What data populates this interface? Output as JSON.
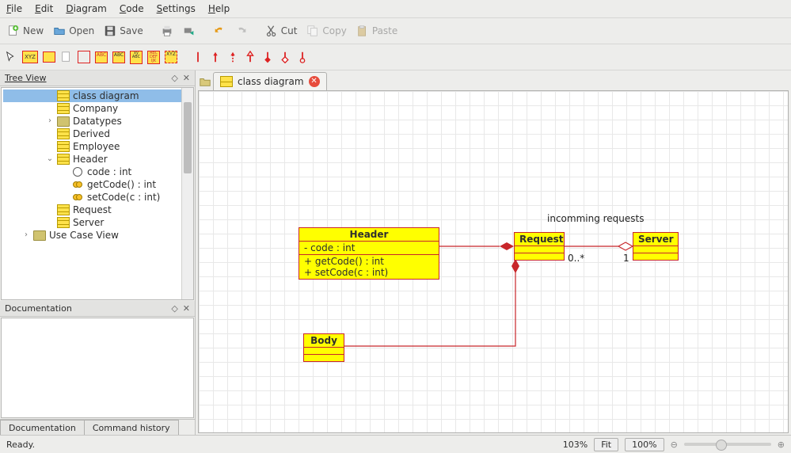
{
  "menu": {
    "file": "File",
    "edit": "Edit",
    "diagram": "Diagram",
    "code": "Code",
    "settings": "Settings",
    "help": "Help"
  },
  "toolbar": {
    "new": "New",
    "open": "Open",
    "save": "Save",
    "cut": "Cut",
    "copy": "Copy",
    "paste": "Paste"
  },
  "panels": {
    "tree_title": "Tree View",
    "doc_title": "Documentation"
  },
  "tree": {
    "items": [
      {
        "label": "class diagram",
        "icon": "class",
        "sel": true,
        "indent": 48,
        "exp": ""
      },
      {
        "label": "Company",
        "icon": "class",
        "indent": 48,
        "exp": ""
      },
      {
        "label": "Datatypes",
        "icon": "folder",
        "indent": 48,
        "exp": ">"
      },
      {
        "label": "Derived",
        "icon": "class",
        "indent": 48,
        "exp": ""
      },
      {
        "label": "Employee",
        "icon": "class",
        "indent": 48,
        "exp": ""
      },
      {
        "label": "Header",
        "icon": "class",
        "indent": 48,
        "exp": "v"
      },
      {
        "label": "code : int",
        "icon": "attr",
        "indent": 66,
        "exp": ""
      },
      {
        "label": "getCode() : int",
        "icon": "op",
        "indent": 66,
        "exp": ""
      },
      {
        "label": "setCode(c : int)",
        "icon": "op",
        "indent": 66,
        "exp": ""
      },
      {
        "label": "Request",
        "icon": "class",
        "indent": 48,
        "exp": ""
      },
      {
        "label": "Server",
        "icon": "class",
        "indent": 48,
        "exp": ""
      },
      {
        "label": "Use Case View",
        "icon": "folder",
        "indent": 18,
        "exp": ">"
      }
    ]
  },
  "bottabs": {
    "doc": "Documentation",
    "hist": "Command history"
  },
  "tab": {
    "label": "class diagram"
  },
  "uml": {
    "header": {
      "title": "Header",
      "attr": "- code : int",
      "op1": "+ getCode() : int",
      "op2": "+ setCode(c : int)"
    },
    "request": {
      "title": "Request"
    },
    "server": {
      "title": "Server"
    },
    "body": {
      "title": "Body"
    },
    "note": "incomming requests",
    "mult_left": "0..*",
    "mult_right": "1"
  },
  "status": {
    "ready": "Ready.",
    "zoom": "103%",
    "fit": "Fit",
    "hundred": "100%"
  }
}
